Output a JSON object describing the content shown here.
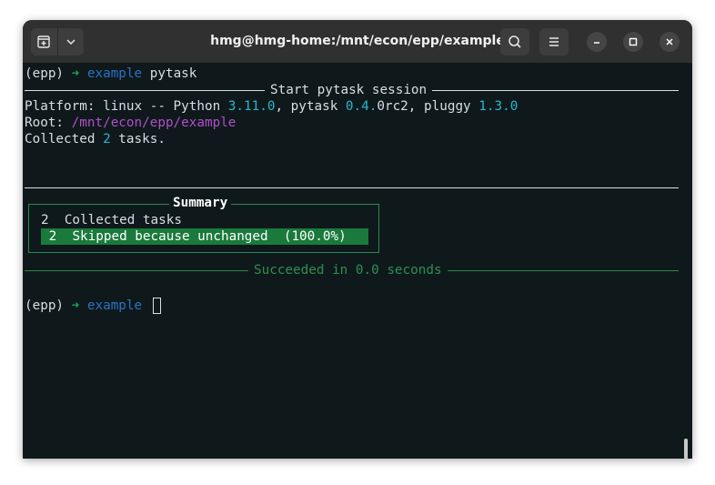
{
  "window": {
    "title": "hmg@hmg-home:/mnt/econ/epp/example"
  },
  "icons": {
    "new_tab": "new-tab-icon",
    "menu_down": "chevron-down-icon",
    "search": "search-icon",
    "hamburger": "hamburger-menu-icon",
    "minimize": "minimize-icon",
    "maximize": "maximize-icon",
    "close": "close-icon"
  },
  "colors": {
    "terminal_bg": "#0f191c",
    "titlebar_bg": "#303030",
    "green": "#1fa15a",
    "blue": "#2a73c4",
    "cyan": "#2ab5cc",
    "magenta": "#b04fc9",
    "highlight": "#1a7a3c"
  },
  "terminal": {
    "prompt1": {
      "env": "(epp)",
      "arrow": "➜",
      "dir": "example",
      "command": "pytask"
    },
    "session_rule": "Start pytask session",
    "platform": {
      "prefix": "Platform: linux -- Python ",
      "python_version": "3.11.0",
      "sep1": ", pytask ",
      "pytask_version_a": "0.4.",
      "pytask_version_b": "0rc2",
      "sep2": ", pluggy ",
      "pluggy_version": "1.3.0"
    },
    "root": {
      "label": "Root: ",
      "path": "/mnt/econ/epp/example"
    },
    "collected": {
      "prefix": "Collected ",
      "count": "2",
      "suffix": " tasks."
    },
    "summary": {
      "title": "Summary",
      "rows": [
        {
          "count": "2",
          "label": "Collected tasks",
          "pct": ""
        },
        {
          "count": "2",
          "label": "Skipped because unchanged",
          "pct": "(100.0%)"
        }
      ]
    },
    "result_rule": "Succeeded in 0.0 seconds",
    "prompt2": {
      "env": "(epp)",
      "arrow": "➜",
      "dir": "example"
    }
  }
}
